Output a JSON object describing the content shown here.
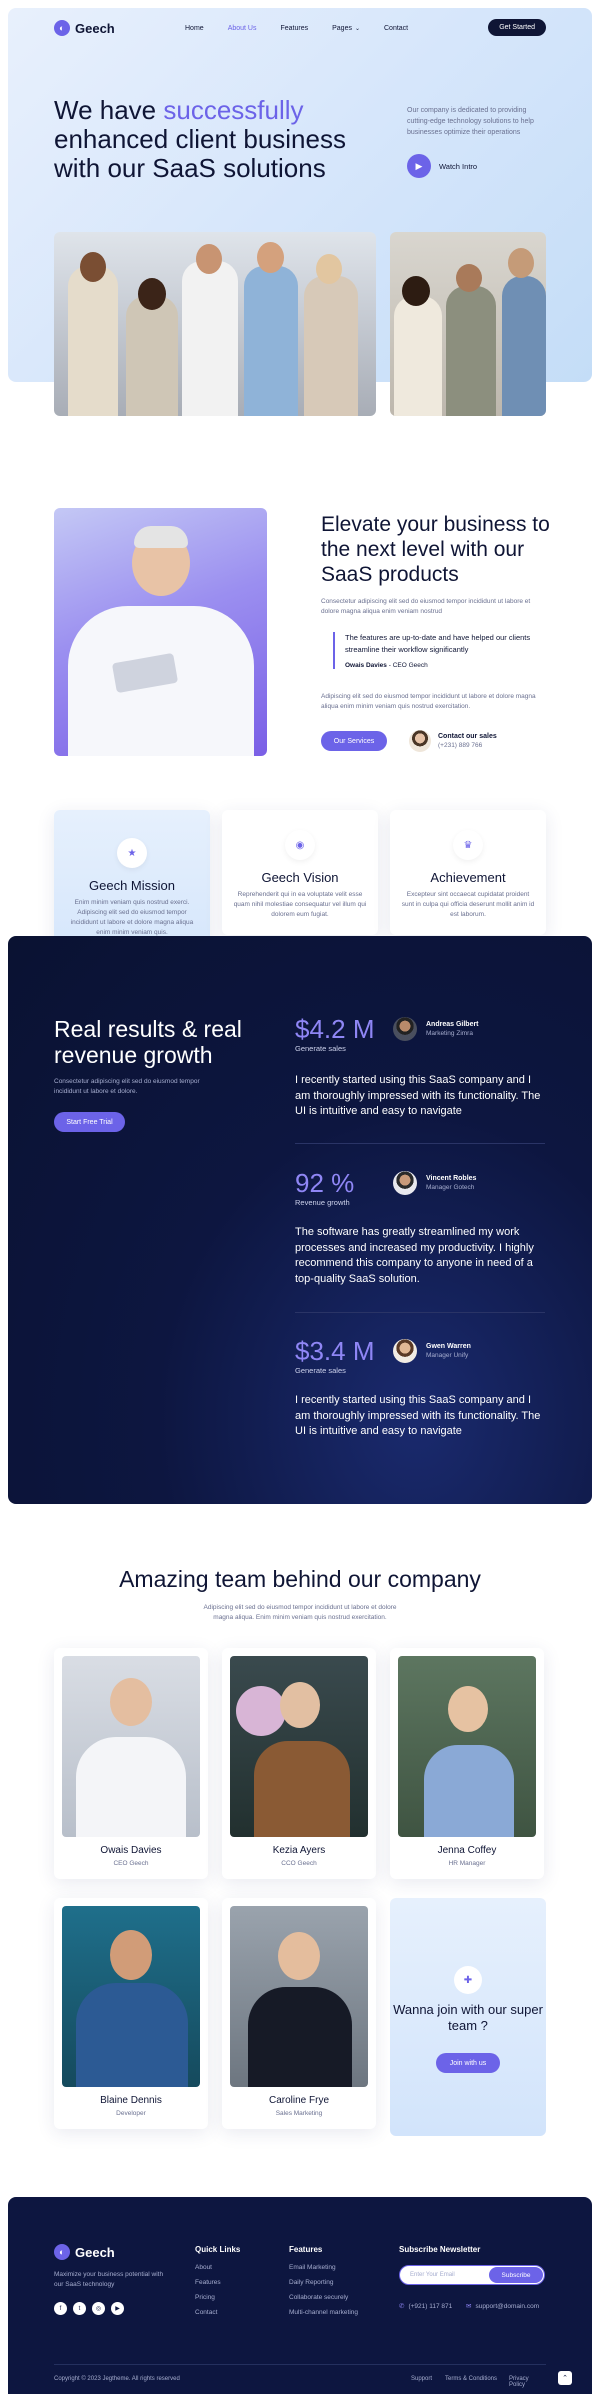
{
  "nav": {
    "brand": "Geech",
    "items": [
      "Home",
      "About Us",
      "Features",
      "Pages",
      "Contact"
    ],
    "cta": "Get Started"
  },
  "hero": {
    "title_pre": "We have ",
    "title_accent": "successfully",
    "title_post": " enhanced client business with our SaaS solutions",
    "description": "Our company is dedicated to providing cutting-edge technology solutions to help businesses optimize their operations",
    "watch": "Watch Intro"
  },
  "about": {
    "title": "Elevate your business to the next level with our SaaS products",
    "paragraph1": "Consectetur adipiscing elit sed do eiusmod tempor incididunt ut labore et dolore magna aliqua enim veniam nostrud",
    "quote": "The features are up-to-date and have helped our clients streamline their workflow significantly",
    "quote_author": "Owais Davies",
    "quote_role": " - CEO Geech",
    "paragraph2": "Adipiscing elit sed do eiusmod tempor incididunt ut labore et dolore magna aliqua enim minim veniam quis nostrud exercitation.",
    "button": "Our Services",
    "contact_label": "Contact our sales",
    "contact_phone": "(+231) 889 766"
  },
  "cards": [
    {
      "title": "Geech Mission",
      "text": "Enim minim veniam quis nostrud exerci. Adipiscing elit sed do eiusmod tempor incididunt ut labore et dolore magna aliqua enim minim veniam quis."
    },
    {
      "title": "Geech Vision",
      "text": "Reprehenderit qui in ea voluptate velit esse quam nihil molestiae consequatur vel illum qui dolorem eum fugiat."
    },
    {
      "title": "Achievement",
      "text": "Excepteur sint occaecat cupidatat proident sunt in culpa qui officia deserunt mollit anim id est laborum."
    }
  ],
  "results": {
    "title": "Real results & real revenue growth",
    "text": "Consectetur adipiscing elit sed do eiusmod tempor incididunt ut labore et dolore.",
    "button": "Start Free Trial",
    "stats": [
      {
        "value": "$4.2 M",
        "label": "Generate sales",
        "name": "Andreas Gilbert",
        "role": "Marketing Zimra",
        "testimonial": "I recently started using this SaaS company and I am thoroughly impressed with its functionality. The UI is intuitive and easy to navigate"
      },
      {
        "value": "92 %",
        "label": "Revenue growth",
        "name": "Vincent Robles",
        "role": "Manager Gotech",
        "testimonial": "The software has greatly streamlined my work processes and increased my productivity. I highly recommend this company to anyone in need of a top-quality SaaS solution."
      },
      {
        "value": "$3.4 M",
        "label": "Generate sales",
        "name": "Gwen Warren",
        "role": "Manager Unify",
        "testimonial": "I recently started using this SaaS company and I am thoroughly impressed with its functionality. The UI is intuitive and easy to navigate"
      }
    ]
  },
  "team": {
    "title": "Amazing team behind our company",
    "text": "Adipiscing elit sed do eiusmod tempor incididunt ut labore et dolore magna aliqua. Enim minim veniam quis nostrud exercitation.",
    "members": [
      {
        "name": "Owais Davies",
        "role": "CEO Geech"
      },
      {
        "name": "Kezia Ayers",
        "role": "CCO Geech"
      },
      {
        "name": "Jenna Coffey",
        "role": "HR Manager"
      },
      {
        "name": "Blaine Dennis",
        "role": "Developer"
      },
      {
        "name": "Caroline Frye",
        "role": "Sales Marketing"
      }
    ],
    "join_title": "Wanna join with our super team ?",
    "join_button": "Join with us"
  },
  "footer": {
    "brand": "Geech",
    "tagline": "Maximize your business potential with our SaaS technology",
    "quick_links_title": "Quick Links",
    "quick_links": [
      "About",
      "Features",
      "Pricing",
      "Contact"
    ],
    "features_title": "Features",
    "features": [
      "Email Marketing",
      "Daily Reporting",
      "Collaborate securely",
      "Multi-channel marketing"
    ],
    "newsletter_title": "Subscribe Newsletter",
    "newsletter_placeholder": "Enter Your Email",
    "newsletter_button": "Subscribe",
    "phone": "(+921) 117 871",
    "email": "support@domain.com",
    "copyright": "Copyright © 2023 Jegtheme. All rights reserved",
    "bottom_links": [
      "Support",
      "Terms & Conditions",
      "Privacy Policy"
    ]
  },
  "colors": {
    "accent": "#6c63e8",
    "navy": "#0d1640",
    "text": "#0f1535"
  }
}
